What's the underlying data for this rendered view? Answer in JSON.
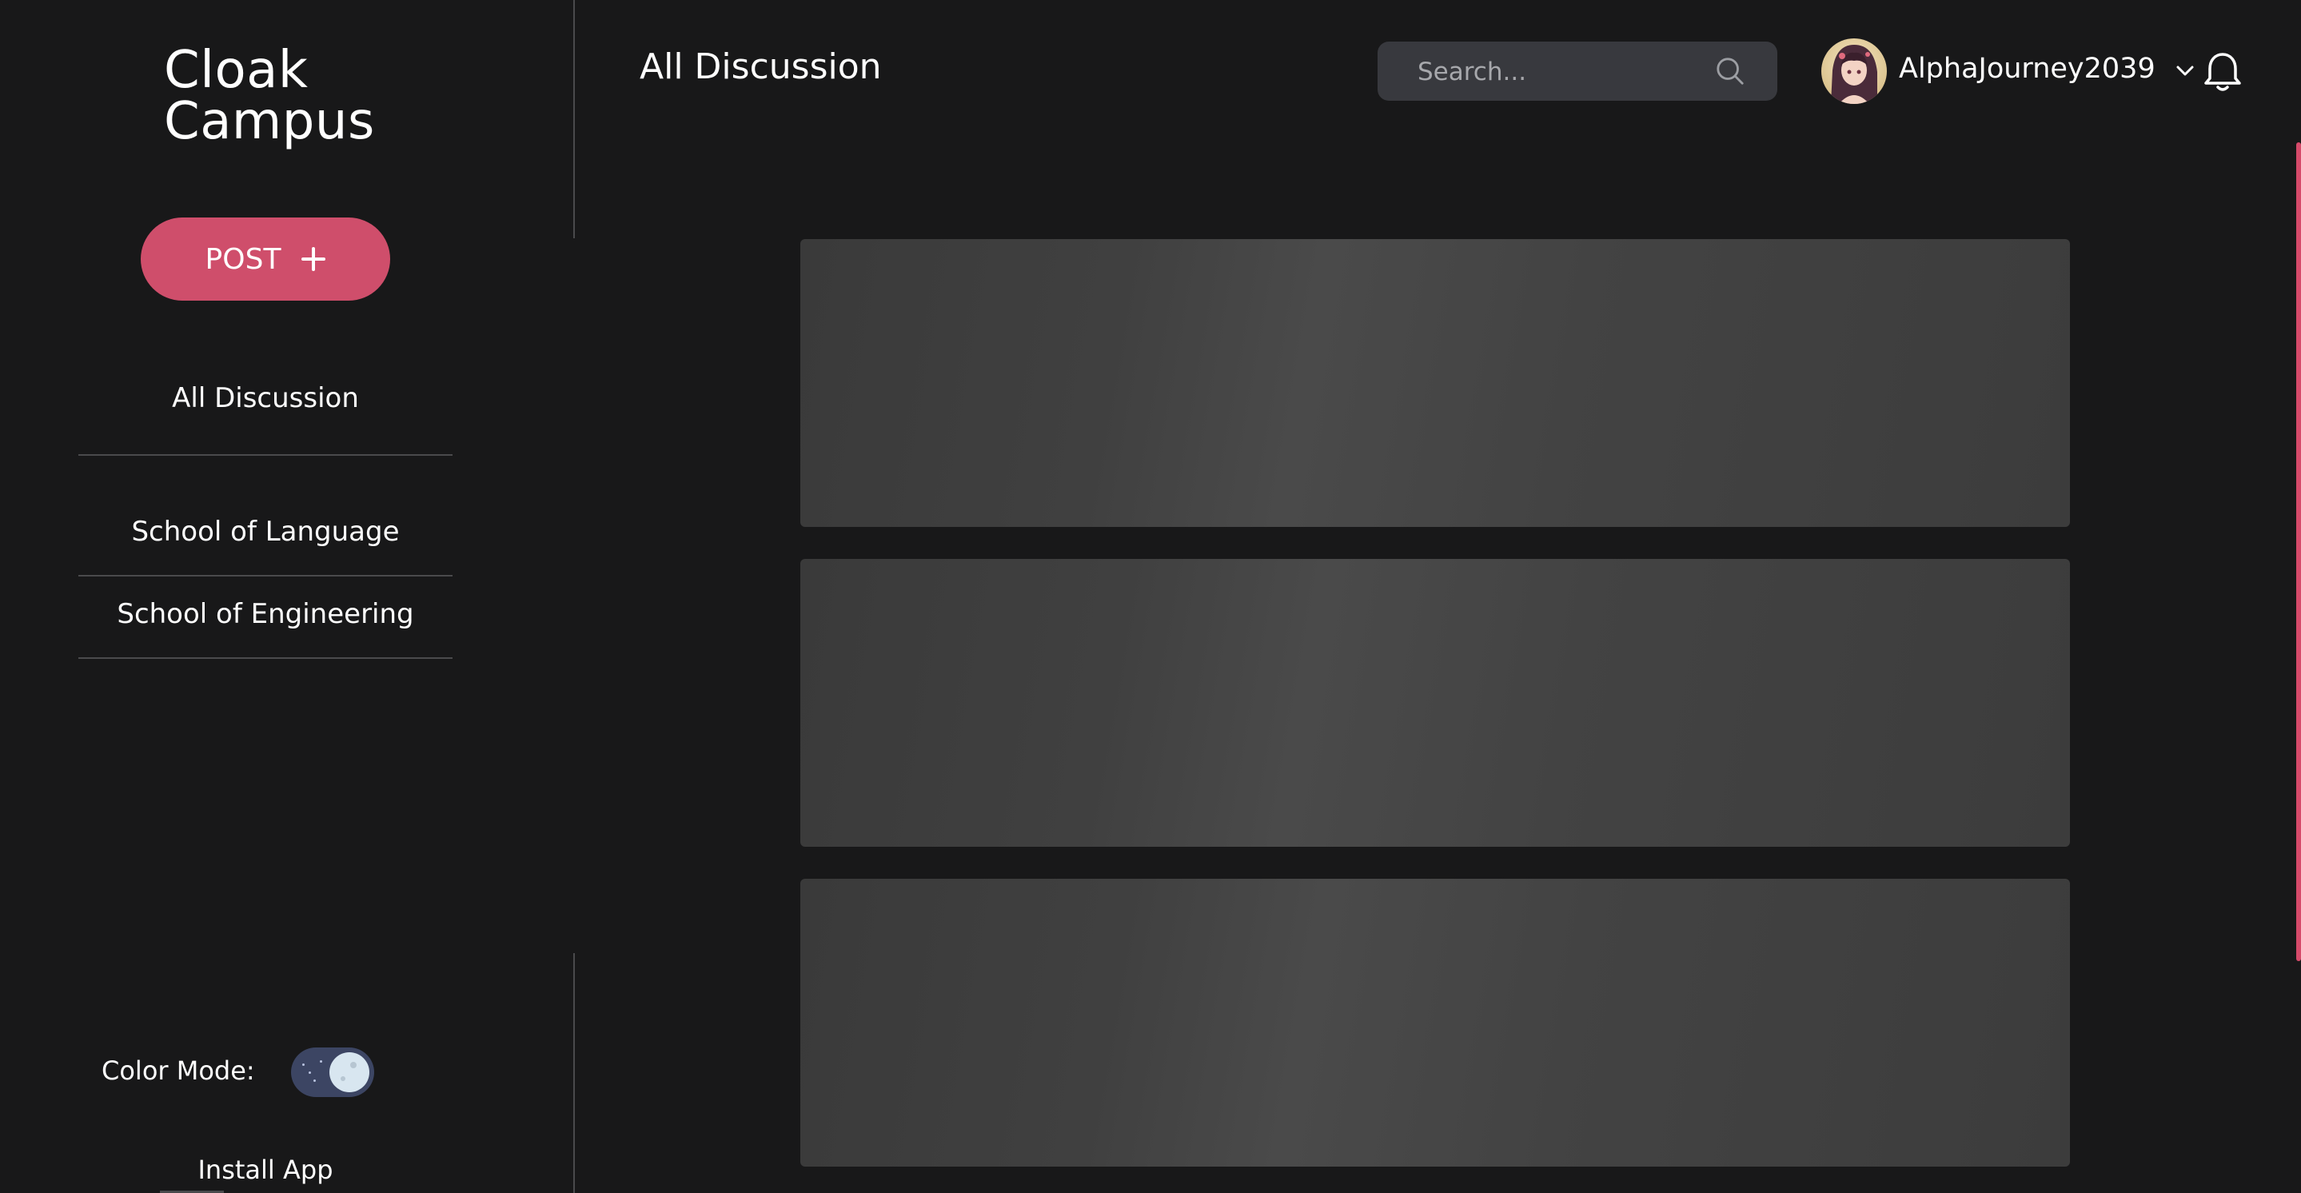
{
  "app": {
    "logo_line1": "Cloak",
    "logo_line2": "Campus"
  },
  "sidebar": {
    "post_button_label": "POST",
    "items": [
      {
        "label": "All Discussion"
      },
      {
        "label": "School of Language"
      },
      {
        "label": "School of Engineering"
      }
    ],
    "color_mode_label": "Color Mode:",
    "color_mode_dark": true,
    "install_app_label": "Install App"
  },
  "header": {
    "title": "All Discussion",
    "search_placeholder": "Search...",
    "search_value": "",
    "username": "AlphaJourney2039"
  },
  "main": {
    "loading_cards": 3
  },
  "icons": {
    "post": "plus-icon",
    "search": "search-icon",
    "user_menu": "chevron-down-icon",
    "notifications": "bell-icon",
    "color_mode": "moon-icon"
  },
  "colors": {
    "background": "#181819",
    "accent": "#cf4e6b",
    "search_bg": "#38393e",
    "toggle_bg": "#3c4563",
    "skeleton": "#404040"
  }
}
